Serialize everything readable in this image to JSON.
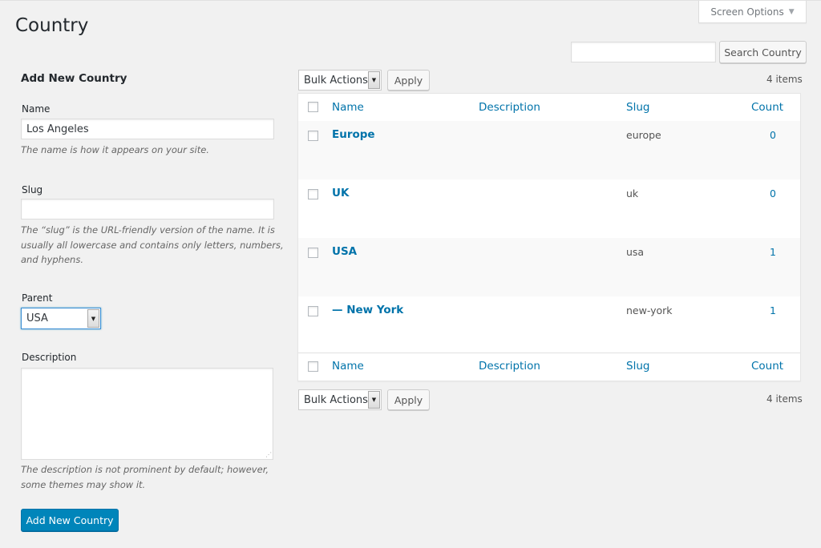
{
  "screen_options": {
    "label": "Screen Options",
    "caret": "▼"
  },
  "page_title": "Country",
  "search": {
    "value": "",
    "button": "Search Country"
  },
  "form": {
    "heading": "Add New Country",
    "name": {
      "label": "Name",
      "value": "Los Angeles",
      "help": "The name is how it appears on your site."
    },
    "slug": {
      "label": "Slug",
      "value": "",
      "help": "The “slug” is the URL-friendly version of the name. It is usually all lowercase and contains only letters, numbers, and hyphens."
    },
    "parent": {
      "label": "Parent",
      "value": "USA"
    },
    "description": {
      "label": "Description",
      "value": "",
      "help": "The description is not prominent by default; however, some themes may show it."
    },
    "submit": "Add New Country"
  },
  "bulk": {
    "label": "Bulk Actions",
    "apply": "Apply"
  },
  "items_count": "4 items",
  "table": {
    "columns": {
      "name": "Name",
      "description": "Description",
      "slug": "Slug",
      "count": "Count"
    },
    "rows": [
      {
        "name": "Europe",
        "slug": "europe",
        "count": "0"
      },
      {
        "name": "UK",
        "slug": "uk",
        "count": "0"
      },
      {
        "name": "USA",
        "slug": "usa",
        "count": "1"
      },
      {
        "name": "— New York",
        "slug": "new-york",
        "count": "1"
      }
    ]
  }
}
